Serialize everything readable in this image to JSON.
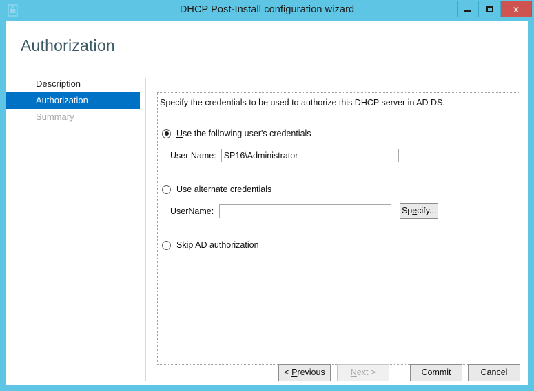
{
  "window": {
    "title": "DHCP Post-Install configuration wizard",
    "icon": "wizard-document-icon",
    "title_bar_color": "#5ec6e4",
    "close_button_color": "#cf5350",
    "controls": {
      "minimize": "minimize-icon",
      "maximize": "maximize-icon",
      "close": "x"
    }
  },
  "page": {
    "heading": "Authorization",
    "heading_color": "#3d5a66"
  },
  "nav": {
    "selected_color": "#0072c6",
    "items": [
      {
        "label": "Description",
        "state": "normal"
      },
      {
        "label": "Authorization",
        "state": "selected"
      },
      {
        "label": "Summary",
        "state": "disabled"
      }
    ]
  },
  "main": {
    "intro": "Specify the credentials to be used to authorize this DHCP server in AD DS.",
    "options": [
      {
        "id": "use-following-credentials",
        "label_pre": "",
        "label_accel": "U",
        "label_post": "se the following user's credentials",
        "checked": true,
        "field_label": "User Name:",
        "field_value": "SP16\\Administrator",
        "field_placeholder": ""
      },
      {
        "id": "use-alternate-credentials",
        "label_pre": "U",
        "label_accel": "s",
        "label_post": "e alternate credentials",
        "checked": false,
        "field_label": "UserName:",
        "field_value": "",
        "field_placeholder": "",
        "button_pre": "Sp",
        "button_accel": "e",
        "button_post": "cify..."
      },
      {
        "id": "skip-ad-authorization",
        "label_pre": "S",
        "label_accel": "k",
        "label_post": "ip AD authorization",
        "checked": false
      }
    ]
  },
  "footer": {
    "previous": {
      "pre": "< ",
      "accel": "P",
      "post": "revious",
      "disabled": false
    },
    "next": {
      "pre": "",
      "accel": "N",
      "post": "ext >",
      "disabled": true
    },
    "commit": {
      "label": "Commit",
      "disabled": false
    },
    "cancel": {
      "label": "Cancel",
      "disabled": false
    }
  }
}
